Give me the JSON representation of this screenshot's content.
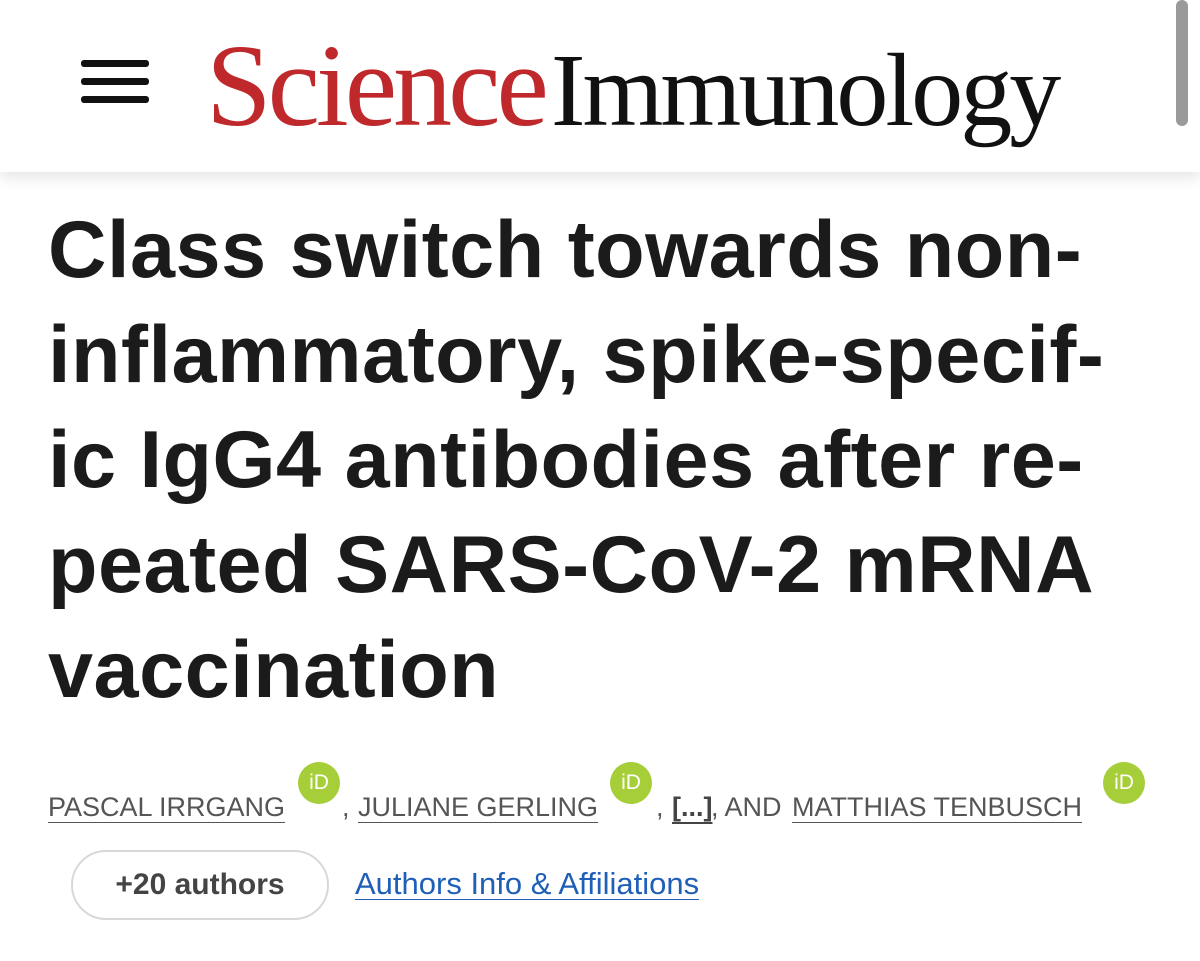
{
  "header": {
    "logo": {
      "brand": "Science",
      "journal": "Immunology",
      "brand_color": "#c0292b",
      "journal_color": "#111111"
    },
    "menu_icon": "hamburger-menu-icon"
  },
  "article": {
    "title_lines": [
      "Class switch towards non-",
      "inflammatory, spike-specif-",
      "ic IgG4 antibodies after re-",
      "peated SARS-CoV-2 mRNA",
      "vaccination"
    ]
  },
  "authors": {
    "list": [
      {
        "name": "PASCAL IRRGANG",
        "orcid": "iD"
      },
      {
        "name": "JULIANE GERLING",
        "orcid": "iD"
      },
      {
        "name": "MATTHIAS TENBUSCH",
        "orcid": "iD"
      }
    ],
    "separators": {
      "comma": ",",
      "ellipsis": "[...]",
      "and": ", AND"
    },
    "more_button": "+20 authors",
    "affiliations_link": "Authors Info & Affiliations",
    "orcid_color": "#a6ce39",
    "link_color": "#1f5fb8"
  }
}
